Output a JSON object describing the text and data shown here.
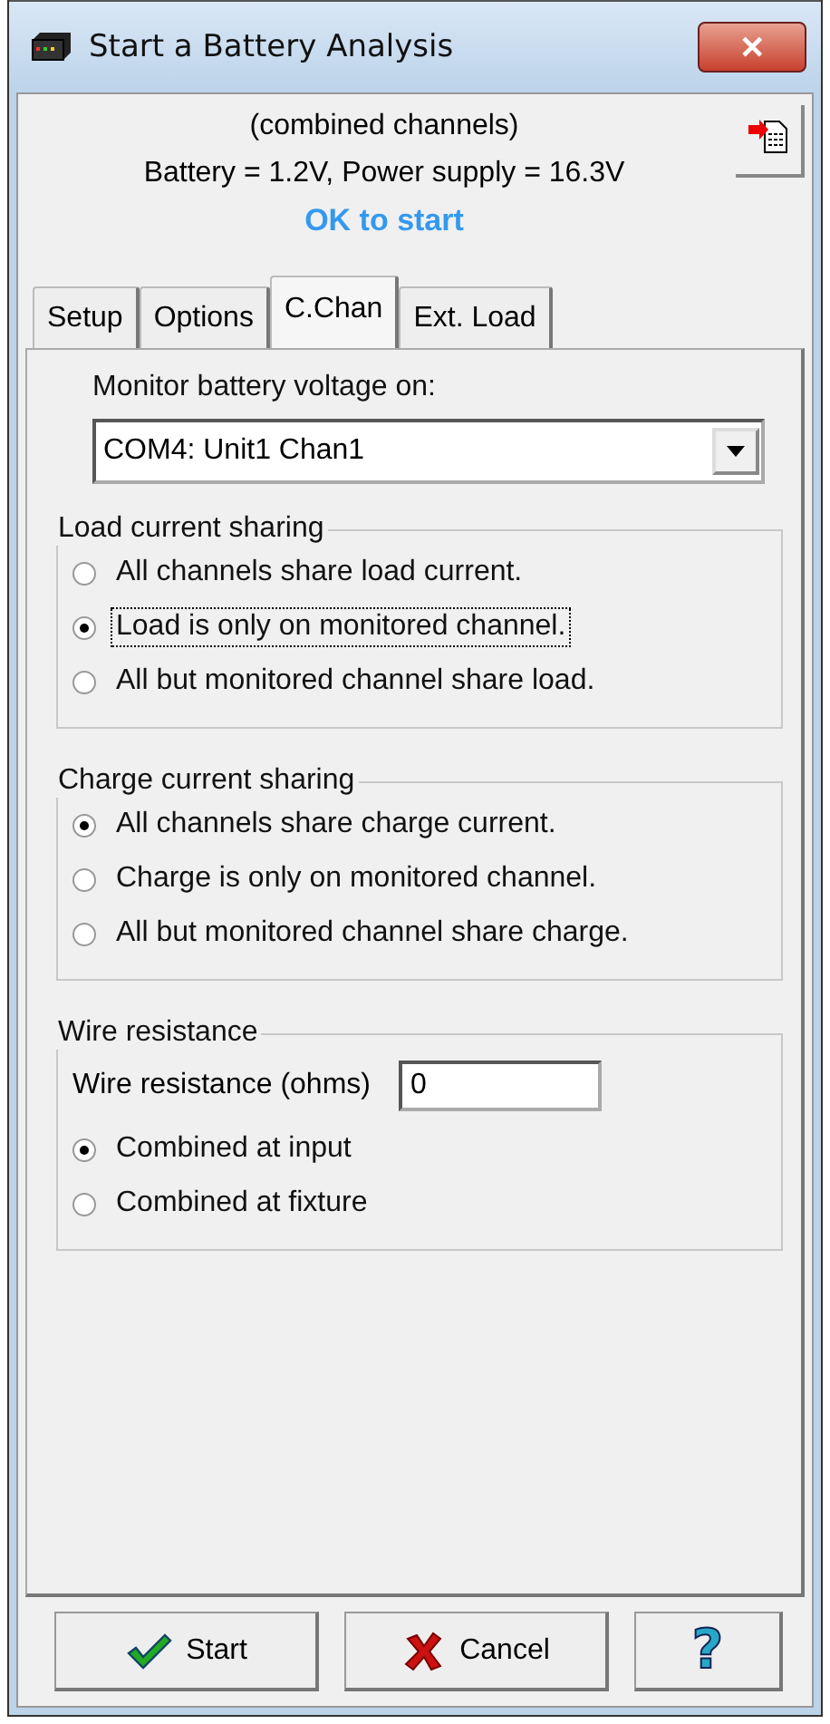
{
  "window": {
    "title": "Start a Battery Analysis",
    "close": "✕"
  },
  "header": {
    "mode": "(combined channels)",
    "readings": "Battery = 1.2V, Power supply = 16.3V",
    "status": "OK to start"
  },
  "tabs": [
    {
      "label": "Setup",
      "selected": false
    },
    {
      "label": "Options",
      "selected": false
    },
    {
      "label": "C.Chan",
      "selected": true
    },
    {
      "label": "Ext. Load",
      "selected": false
    }
  ],
  "monitor": {
    "label": "Monitor battery voltage on:",
    "value": "COM4: Unit1 Chan1"
  },
  "groups": [
    {
      "title": "Load current sharing",
      "options": [
        {
          "label": "All channels share load current.",
          "selected": false,
          "focused": false
        },
        {
          "label": "Load is only on monitored channel.",
          "selected": true,
          "focused": true
        },
        {
          "label": "All but monitored channel share load.",
          "selected": false,
          "focused": false
        }
      ]
    },
    {
      "title": "Charge current sharing",
      "options": [
        {
          "label": "All channels share charge current.",
          "selected": true,
          "focused": false
        },
        {
          "label": "Charge is only on monitored channel.",
          "selected": false,
          "focused": false
        },
        {
          "label": "All but monitored channel share charge.",
          "selected": false,
          "focused": false
        }
      ]
    },
    {
      "title": "Wire resistance",
      "field": {
        "label": "Wire resistance (ohms)",
        "value": "0"
      },
      "options": [
        {
          "label": "Combined at input",
          "selected": true,
          "focused": false
        },
        {
          "label": "Combined at fixture",
          "selected": false,
          "focused": false
        }
      ]
    }
  ],
  "buttons": [
    {
      "kind": "start",
      "label": "Start"
    },
    {
      "kind": "cancel",
      "label": "Cancel"
    },
    {
      "kind": "help",
      "label": "?"
    }
  ]
}
